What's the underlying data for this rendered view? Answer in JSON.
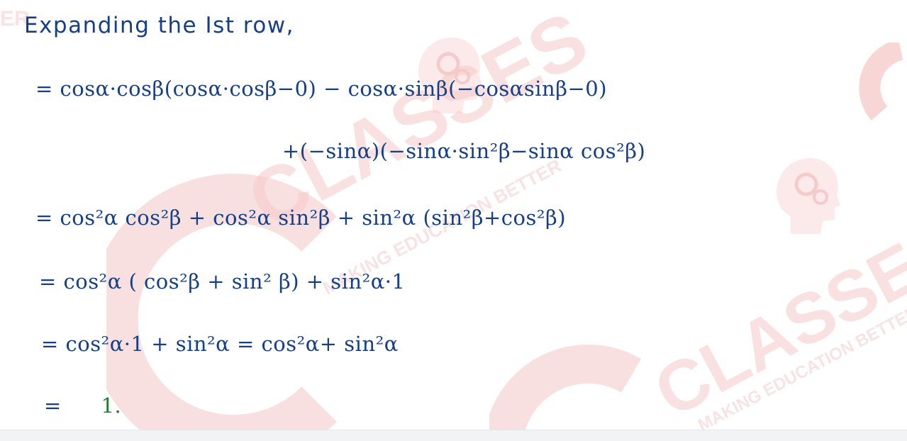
{
  "watermark": {
    "brand": "CLASSES",
    "brand_right": "CLASSES",
    "tagline": "MAKING EDUCATION BETTER",
    "tagline_right": "MAKING EDUCATION BETTER",
    "corner_text": "ER",
    "color": "#f2b8b8"
  },
  "solution": {
    "heading": "Expanding the Ist row,",
    "step1_line1": "= cosα·cosβ(cosα·cosβ−0) − cosα·sinβ(−cosαsinβ−0)",
    "step1_line2": "+(−sinα)(−sinα·sin²β−sinα cos²β)",
    "step2": "= cos²α cos²β + cos²α sin²β + sin²α (sin²β+cos²β)",
    "step3": "= cos²α ( cos²β + sin² β) + sin²α·1",
    "step4": "= cos²α·1 + sin²α  =  cos²α+ sin²α",
    "final_eq": "=",
    "final_value": "1.",
    "ink_color": "#163f87",
    "answer_color": "#1e7b2c"
  }
}
